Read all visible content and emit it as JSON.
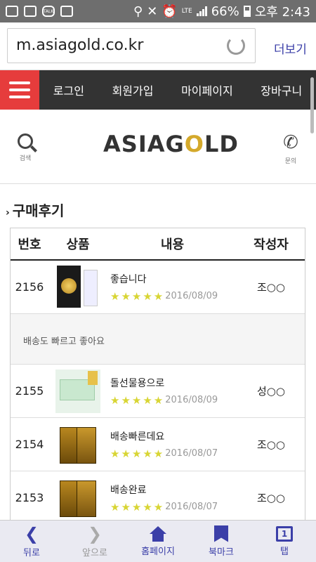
{
  "status_bar": {
    "battery_percent": "66%",
    "time": "오후 2:43",
    "network": "LTE",
    "notification_icons": [
      "gallery-icon",
      "image-icon",
      "talk-icon",
      "download-icon"
    ],
    "talk_label": "TALK"
  },
  "browser": {
    "url": "m.asiagold.co.kr",
    "more_label": "더보기"
  },
  "nav": {
    "items": [
      {
        "label": "로그인"
      },
      {
        "label": "회원가입"
      },
      {
        "label": "마이페이지"
      },
      {
        "label": "장바구니"
      }
    ]
  },
  "header": {
    "logo_left": "ASIAG",
    "logo_gold": "O",
    "logo_right": "LD",
    "search_label": "검색",
    "inquiry_label": "문의"
  },
  "section": {
    "title": "구매후기"
  },
  "table": {
    "headers": {
      "no": "번호",
      "product": "상품",
      "content": "내용",
      "author": "작성자"
    },
    "rows": [
      {
        "no": "2156",
        "title": "좋습니다",
        "stars": "★★★★★",
        "date": "2016/08/09",
        "author": "조○○",
        "img": "card"
      },
      {
        "no": "2155",
        "title": "돌선물용으로",
        "stars": "★★★★★",
        "date": "2016/08/09",
        "author": "성○○",
        "img": "green"
      },
      {
        "no": "2154",
        "title": "배송빠른데요",
        "stars": "★★★★★",
        "date": "2016/08/07",
        "author": "조○○",
        "img": "bars"
      },
      {
        "no": "2153",
        "title": "배송완료",
        "stars": "★★★★★",
        "date": "2016/08/07",
        "author": "조○○",
        "img": "bars"
      }
    ],
    "expanded_text": "배송도 빠르고 좋아요"
  },
  "bottom_bar": {
    "back": "뒤로",
    "forward": "앞으로",
    "home": "홈페이지",
    "bookmark": "북마크",
    "tabs": "탭",
    "tab_count": "1"
  },
  "colors": {
    "accent": "#3b3fa8",
    "menu_red": "#e63c3c",
    "nav_bg": "#333333",
    "star": "#d8d534"
  }
}
